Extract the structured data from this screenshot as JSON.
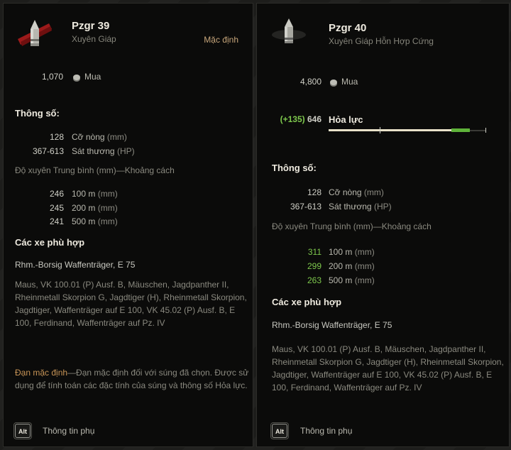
{
  "panel1": {
    "name": "Pzgr 39",
    "type": "Xuyên Giáp",
    "default_badge": "Mặc định",
    "price": "1,070",
    "price_label": "Mua",
    "params_title": "Thông số:",
    "params": [
      {
        "value": "128",
        "label": "Cỡ nòng",
        "unit": "(mm)"
      },
      {
        "value": "367-613",
        "label": "Sát thương",
        "unit": "(HP)"
      }
    ],
    "pen_title": "Độ xuyên Trung bình (mm)—Khoảng cách",
    "pen": [
      {
        "value": "246",
        "dist": "100 m",
        "unit": "(mm)"
      },
      {
        "value": "245",
        "dist": "200 m",
        "unit": "(mm)"
      },
      {
        "value": "241",
        "dist": "500 m",
        "unit": "(mm)"
      }
    ],
    "vehicles_title": "Các xe phù hợp",
    "vehicles_main": "Rhm.-Borsig Waffenträger, E 75",
    "vehicles_others": "Maus, VK 100.01 (P) Ausf. B, Mäuschen, Jagdpanther II, Rheinmetall Skorpion G, Jagdtiger (H), Rheinmetall Skorpion, Jagdtiger, Waffenträger auf E 100, VK 45.02 (P) Ausf. B, E 100, Ferdinand, Waffenträger auf Pz. IV",
    "default_note_title": "Đạn mặc định",
    "default_note_text": "—Đạn mặc định đối với súng đã chọn. Được sử dụng để tính toán các đặc tính của súng và thông số Hỏa lực.",
    "alt_key": "Alt",
    "alt_label": "Thông tin phụ"
  },
  "panel2": {
    "name": "Pzgr 40",
    "type": "Xuyên Giáp Hỗn Hợp Cứng",
    "price": "4,800",
    "price_label": "Mua",
    "firepower_delta": "(+135)",
    "firepower_value": "646",
    "firepower_label": "Hỏa lực",
    "firepower_base_fraction": 0.78,
    "firepower_new_fraction": 0.96,
    "params_title": "Thông số:",
    "params": [
      {
        "value": "128",
        "label": "Cỡ nòng",
        "unit": "(mm)"
      },
      {
        "value": "367-613",
        "label": "Sát thương",
        "unit": "(HP)"
      }
    ],
    "pen_title": "Độ xuyên Trung bình (mm)—Khoảng cách",
    "pen": [
      {
        "value": "311",
        "dist": "100 m",
        "unit": "(mm)"
      },
      {
        "value": "299",
        "dist": "200 m",
        "unit": "(mm)"
      },
      {
        "value": "263",
        "dist": "500 m",
        "unit": "(mm)"
      }
    ],
    "vehicles_title": "Các xe phù hợp",
    "vehicles_main": "Rhm.-Borsig Waffenträger, E 75",
    "vehicles_others": "Maus, VK 100.01 (P) Ausf. B, Mäuschen, Jagdpanther II, Rheinmetall Skorpion G, Jagdtiger (H), Rheinmetall Skorpion, Jagdtiger, Waffenträger auf E 100, VK 45.02 (P) Ausf. B, E 100, Ferdinand, Waffenträger auf Pz. IV",
    "alt_key": "Alt",
    "alt_label": "Thông tin phụ"
  },
  "colors": {
    "accent_green": "#7ec84d",
    "default_note": "#c79456",
    "badge": "#c6a57a"
  }
}
